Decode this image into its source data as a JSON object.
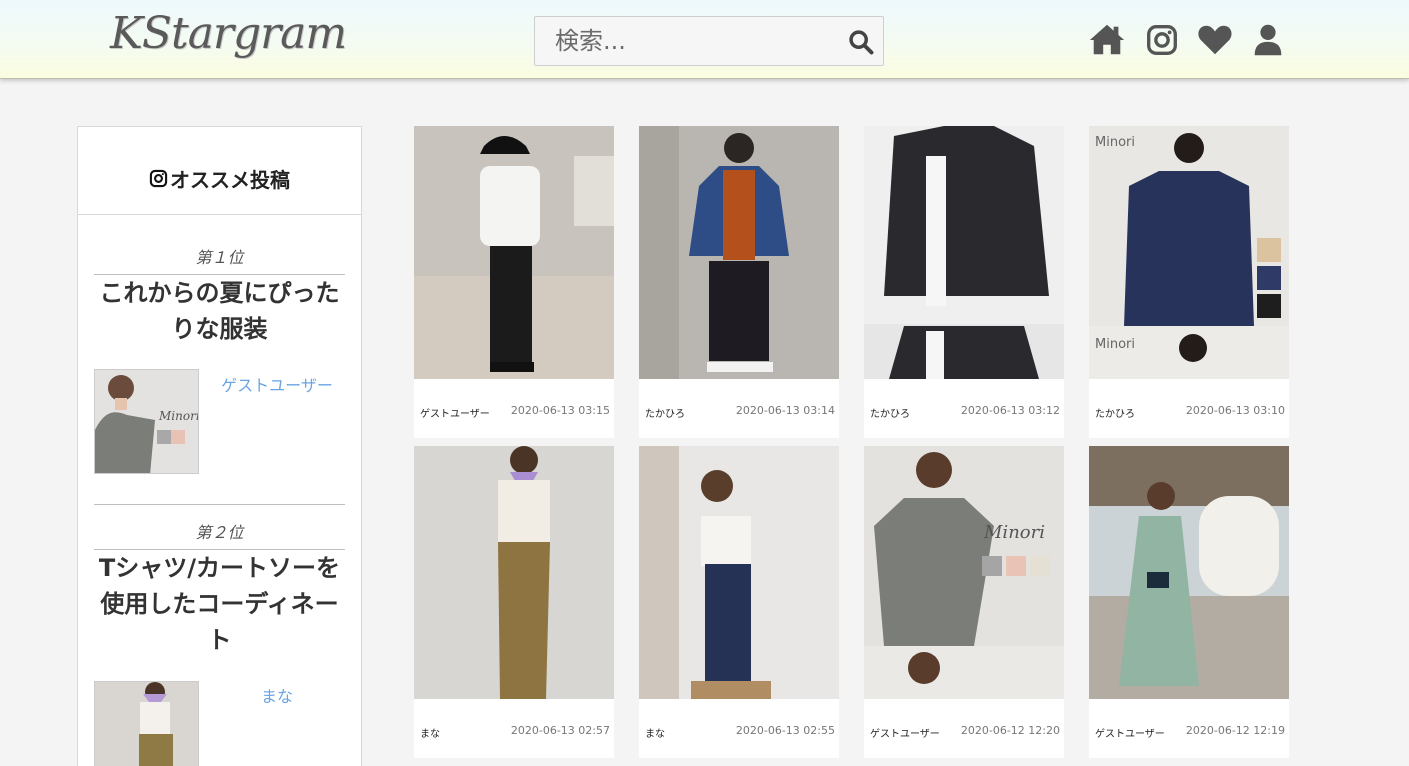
{
  "app": {
    "logo": "KStargram"
  },
  "search": {
    "placeholder": "検索..."
  },
  "nav": [
    {
      "name": "home",
      "icon": "home-icon"
    },
    {
      "name": "instagram",
      "icon": "instagram-icon"
    },
    {
      "name": "likes",
      "icon": "heart-icon"
    },
    {
      "name": "profile",
      "icon": "user-icon"
    }
  ],
  "colors": {
    "accent_link": "#6aa4e3",
    "icon": "#555555"
  },
  "sidebar": {
    "heading": "オススメ投稿",
    "rankings": [
      {
        "rank_label": "第１位",
        "title": "これからの夏にぴったりな服装",
        "user": "ゲストユーザー"
      },
      {
        "rank_label": "第２位",
        "title": "Tシャツ/カートソーを使用したコーディネート",
        "user": "まな"
      }
    ]
  },
  "posts": [
    {
      "user": "ゲストユーザー",
      "date": "2020-06-13 03:15"
    },
    {
      "user": "たかひろ",
      "date": "2020-06-13 03:14"
    },
    {
      "user": "たかひろ",
      "date": "2020-06-13 03:12"
    },
    {
      "user": "たかひろ",
      "date": "2020-06-13 03:10"
    },
    {
      "user": "まな",
      "date": "2020-06-13 02:57"
    },
    {
      "user": "まな",
      "date": "2020-06-13 02:55"
    },
    {
      "user": "ゲストユーザー",
      "date": "2020-06-12 12:20"
    },
    {
      "user": "ゲストユーザー",
      "date": "2020-06-12 12:19"
    }
  ]
}
